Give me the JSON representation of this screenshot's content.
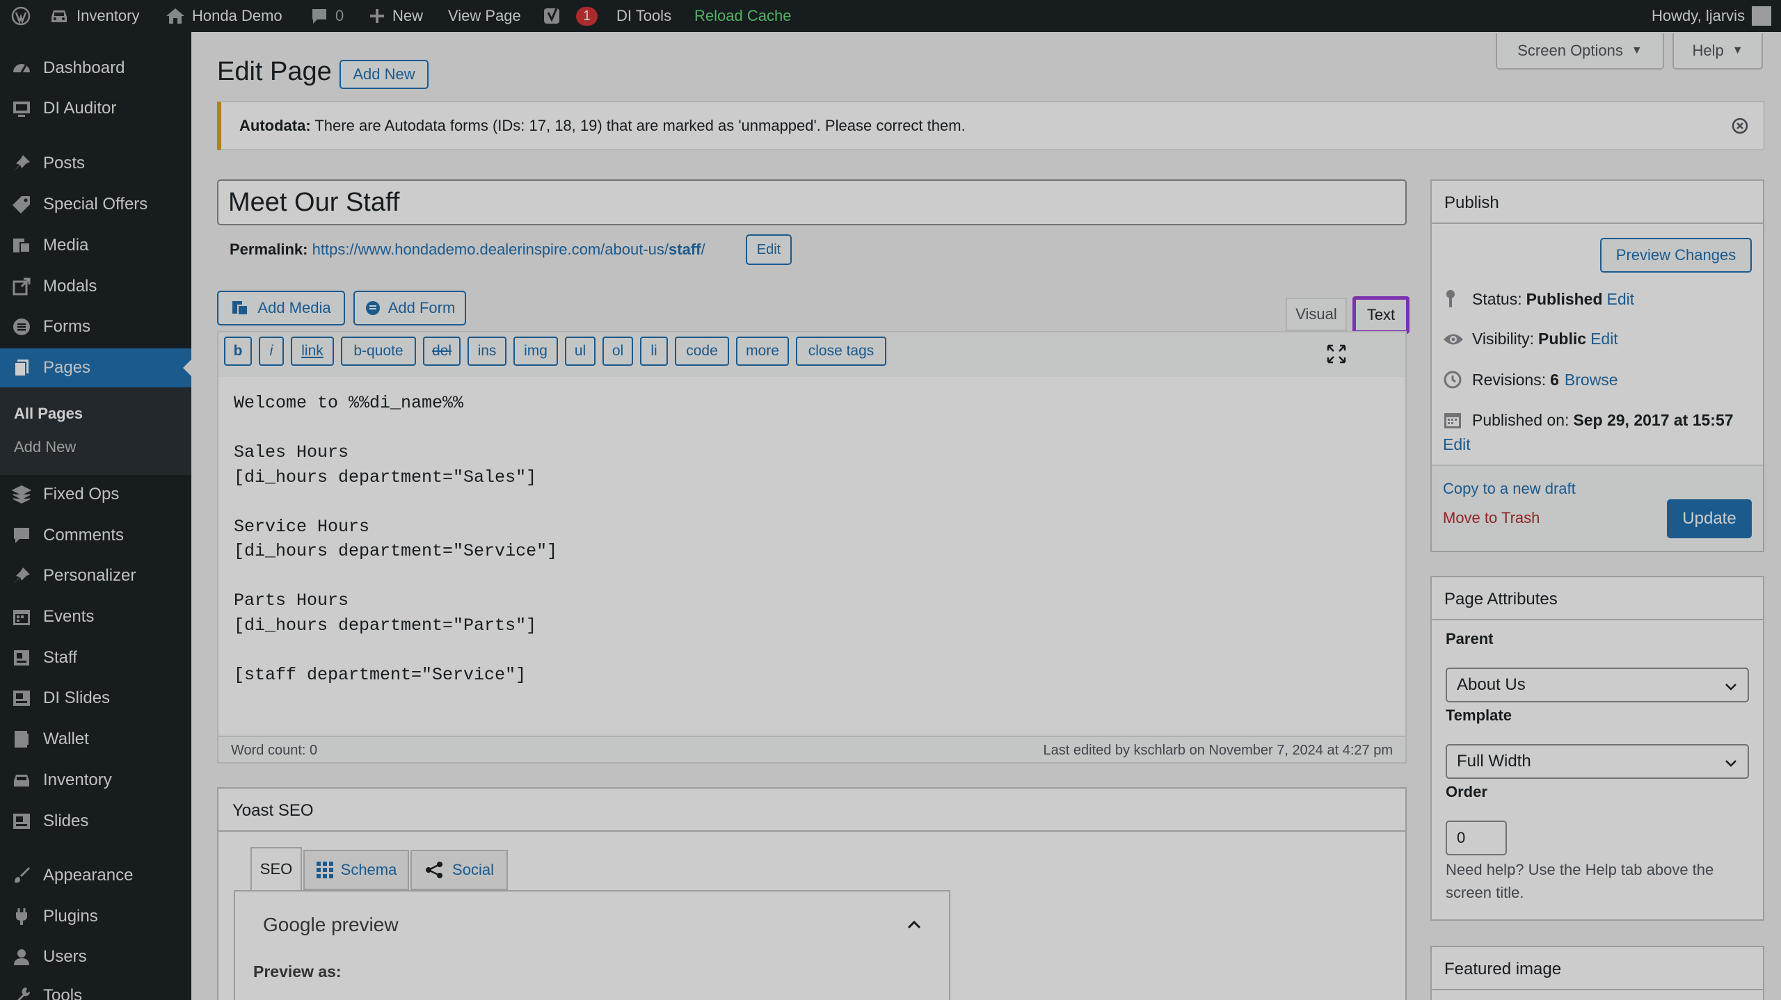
{
  "adminbar": {
    "site_menu": "Inventory",
    "site_name": "Honda Demo",
    "comments_count": "0",
    "new_label": "New",
    "view_page": "View Page",
    "yoast_badge": "1",
    "di_tools": "DI Tools",
    "reload_cache": "Reload Cache",
    "howdy": "Howdy, ljarvis"
  },
  "sidebar": {
    "items": [
      {
        "label": "Dashboard",
        "icon": "dashboard-icon"
      },
      {
        "label": "DI Auditor",
        "icon": "auditor-icon"
      },
      {
        "label": "Posts",
        "icon": "pin-icon"
      },
      {
        "label": "Special Offers",
        "icon": "tag-icon"
      },
      {
        "label": "Media",
        "icon": "media-icon"
      },
      {
        "label": "Modals",
        "icon": "external-icon"
      },
      {
        "label": "Forms",
        "icon": "forms-icon"
      },
      {
        "label": "Pages",
        "icon": "pages-icon"
      },
      {
        "label": "Fixed Ops",
        "icon": "stack-icon"
      },
      {
        "label": "Comments",
        "icon": "comment-icon"
      },
      {
        "label": "Personalizer",
        "icon": "pin-icon"
      },
      {
        "label": "Events",
        "icon": "calendar-icon"
      },
      {
        "label": "Staff",
        "icon": "staff-icon"
      },
      {
        "label": "DI Slides",
        "icon": "slides-icon"
      },
      {
        "label": "Wallet",
        "icon": "wallet-icon"
      },
      {
        "label": "Inventory",
        "icon": "car-icon"
      },
      {
        "label": "Slides",
        "icon": "slides-icon"
      },
      {
        "label": "Appearance",
        "icon": "brush-icon"
      },
      {
        "label": "Plugins",
        "icon": "plugin-icon"
      },
      {
        "label": "Users",
        "icon": "user-icon"
      },
      {
        "label": "Tools",
        "icon": "wrench-icon"
      }
    ],
    "submenu": {
      "all_pages": "All Pages",
      "add_new": "Add New"
    }
  },
  "header": {
    "title": "Edit Page",
    "add_new": "Add New",
    "screen_options": "Screen Options",
    "help": "Help"
  },
  "notice": {
    "bold": "Autodata:",
    "text": " There are Autodata forms (IDs: 17, 18, 19) that are marked as 'unmapped'. Please correct them."
  },
  "post": {
    "title": "Meet Our Staff",
    "permalink_label": "Permalink:",
    "permalink_url": "https://www.hondademo.dealerinspire.com/about-us/",
    "permalink_slug": "staff",
    "permalink_end": "/",
    "permalink_edit": "Edit"
  },
  "editor": {
    "add_media": "Add Media",
    "add_form": "Add Form",
    "tab_visual": "Visual",
    "tab_text": "Text",
    "quicktags": [
      "b",
      "i",
      "link",
      "b-quote",
      "del",
      "ins",
      "img",
      "ul",
      "ol",
      "li",
      "code",
      "more",
      "close tags"
    ],
    "content": "Welcome to %%di_name%%\n\nSales Hours\n[di_hours department=\"Sales\"]\n\nService Hours\n[di_hours department=\"Service\"]\n\nParts Hours\n[di_hours department=\"Parts\"]\n\n[staff department=\"Service\"]",
    "word_count": "Word count: 0",
    "last_edited": "Last edited by kschlarb on November 7, 2024 at 4:27 pm"
  },
  "yoast": {
    "title": "Yoast SEO",
    "tabs": [
      "SEO",
      "Schema",
      "Social"
    ],
    "google_preview": "Google preview",
    "preview_as": "Preview as:"
  },
  "publish": {
    "title": "Publish",
    "preview_changes": "Preview Changes",
    "status_label": "Status:",
    "status_value": "Published",
    "visibility_label": "Visibility:",
    "visibility_value": "Public",
    "revisions_label": "Revisions:",
    "revisions_value": "6",
    "browse": "Browse",
    "published_on_label": "Published on:",
    "published_on_value": "Sep 29, 2017 at 15:57",
    "edit": "Edit",
    "copy_draft": "Copy to a new draft",
    "trash": "Move to Trash",
    "update": "Update"
  },
  "attributes": {
    "title": "Page Attributes",
    "parent_label": "Parent",
    "parent_value": "About Us",
    "template_label": "Template",
    "template_value": "Full Width",
    "order_label": "Order",
    "order_value": "0",
    "help_text": "Need help? Use the Help tab above the screen title."
  },
  "featured": {
    "title": "Featured image"
  },
  "colors": {
    "admin_bar": "#1d2327",
    "accent": "#2271b1",
    "highlight": "#9b3fdc",
    "trash": "#b32d2e",
    "reload": "#68de7c"
  }
}
